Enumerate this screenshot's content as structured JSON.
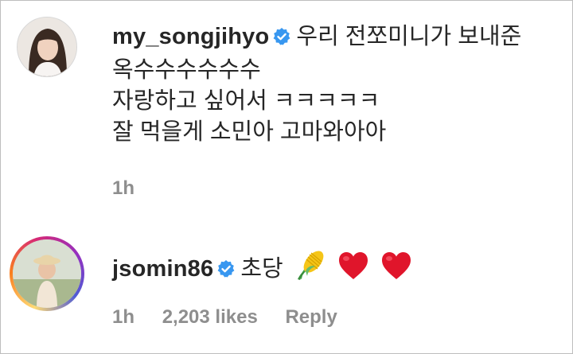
{
  "comments": [
    {
      "username": "my_songjihyo",
      "verified": true,
      "lines": [
        "우리 전쪼미니가 보내준",
        "옥수수수수수수",
        "자랑하고 싶어서 ㅋㅋㅋㅋㅋ",
        "잘 먹을게 소민아 고마와아아"
      ],
      "time": "1h"
    },
    {
      "username": "jsomin86",
      "verified": true,
      "text": "초당",
      "emojis": [
        "corn-emoji",
        "red-heart-emoji",
        "red-heart-emoji"
      ],
      "time": "1h",
      "likes": "2,203 likes",
      "reply": "Reply"
    }
  ],
  "colors": {
    "verified": "#3897f0",
    "meta": "#8e8e8e",
    "text": "#262626",
    "heart": "#e0152b"
  }
}
